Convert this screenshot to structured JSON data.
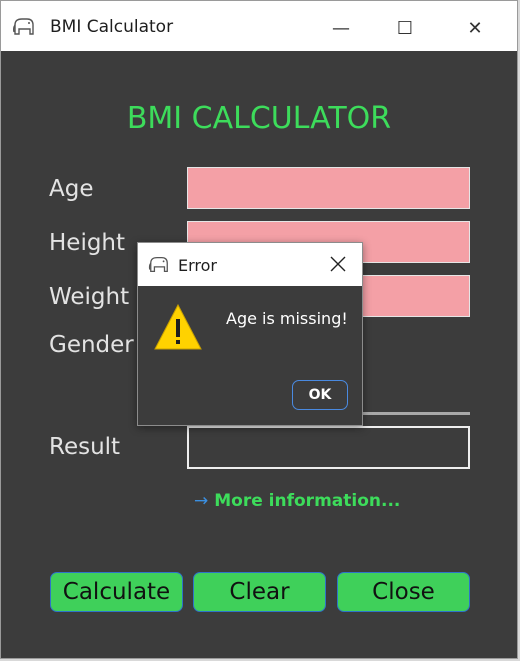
{
  "window": {
    "title": "BMI Calculator",
    "minimize_glyph": "—",
    "maximize_glyph": "☐",
    "close_glyph": "✕"
  },
  "app": {
    "heading": "BMI CALCULATOR",
    "labels": {
      "age": "Age",
      "height": "Height",
      "weight": "Weight",
      "gender": "Gender",
      "result": "Result"
    },
    "fields": {
      "age": "",
      "height": "",
      "weight": "",
      "result": ""
    },
    "more_info": {
      "arrow": "→",
      "label": "More information..."
    },
    "buttons": {
      "calculate": "Calculate",
      "clear": "Clear",
      "close": "Close"
    }
  },
  "dialog": {
    "title": "Error",
    "message": "Age is missing!",
    "ok": "OK",
    "icon": "warning-icon"
  },
  "colors": {
    "accent_green": "#3ddc5b",
    "button_green": "#3fd05a",
    "invalid_field": "#f4a0a6",
    "background": "#3c3c3c",
    "link_arrow": "#3b8fe0"
  }
}
